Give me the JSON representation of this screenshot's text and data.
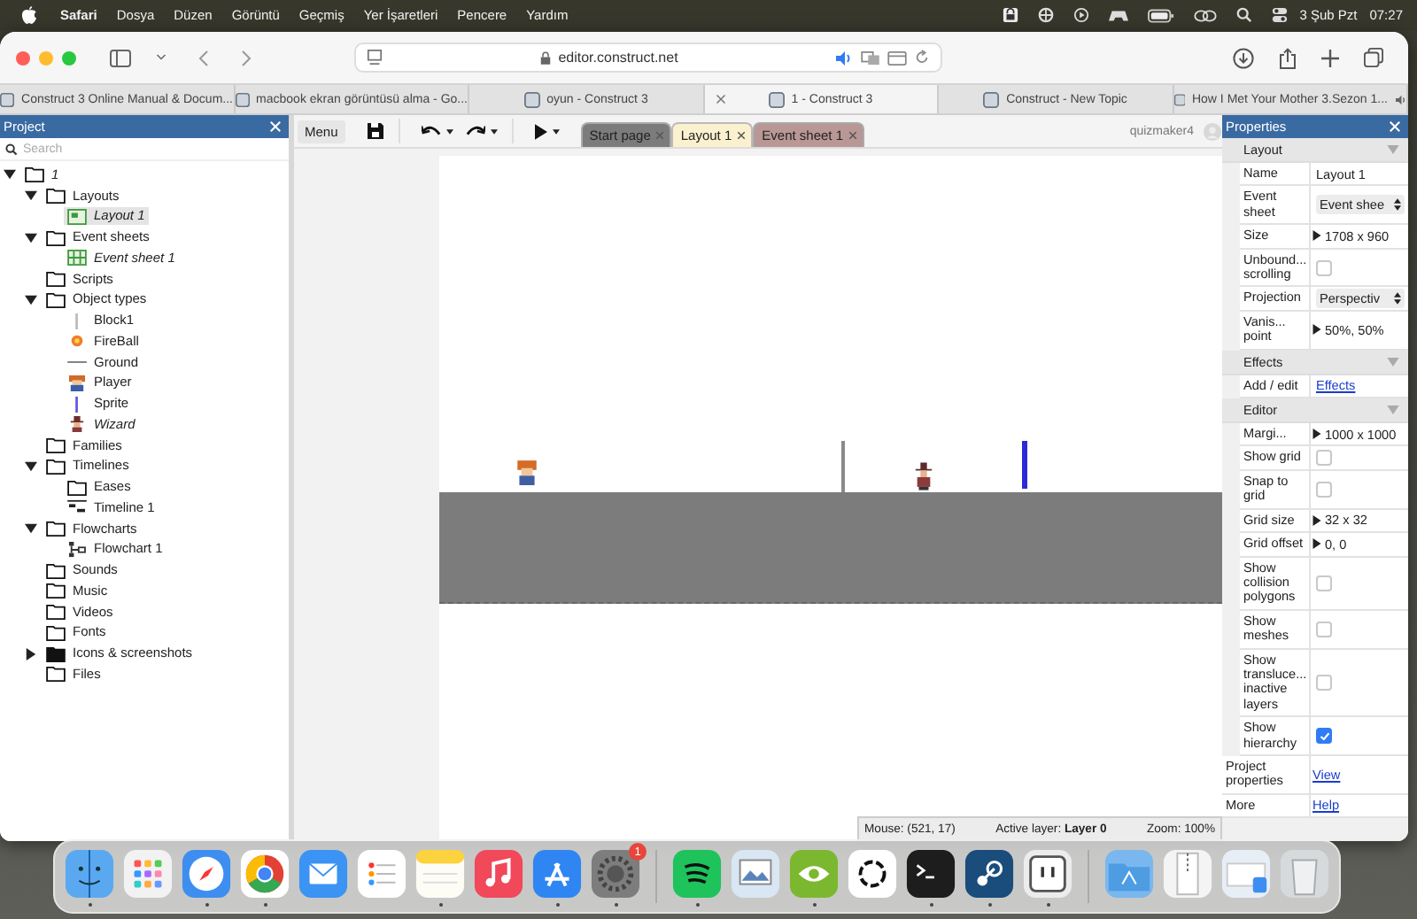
{
  "menu_bar": {
    "app": "Safari",
    "menus": [
      "Dosya",
      "Düzen",
      "Görüntü",
      "Geçmiş",
      "Yer İşaretleri",
      "Pencere",
      "Yardım"
    ],
    "date": "3 Şub Pzt",
    "time": "07:27"
  },
  "browser": {
    "address": "editor.construct.net",
    "tabs": [
      {
        "title": "Construct 3 Online Manual & Docum...",
        "selected": false,
        "audio": false
      },
      {
        "title": "macbook ekran görüntüsü alma - Go...",
        "selected": false,
        "audio": false
      },
      {
        "title": "oyun - Construct 3",
        "selected": false,
        "audio": false
      },
      {
        "title": "1 - Construct 3",
        "selected": true,
        "audio": false
      },
      {
        "title": "Construct - New Topic",
        "selected": false,
        "audio": false
      },
      {
        "title": "How I Met Your Mother 3.Sezon 1...",
        "selected": false,
        "audio": true
      }
    ]
  },
  "toolbar": {
    "menu": "Menu",
    "user": "quizmaker4",
    "tabs": [
      {
        "label": "Start page",
        "color": "#7c7c7c",
        "selected": false
      },
      {
        "label": "Layout 1",
        "color": "#fbf1cf",
        "selected": true
      },
      {
        "label": "Event sheet 1",
        "color": "#b89795",
        "selected": false
      }
    ]
  },
  "project": {
    "title": "Project",
    "search_placeholder": "Search",
    "tree": [
      {
        "label": "1",
        "kind": "folder",
        "italic": true,
        "selected": false,
        "expanded": true,
        "children": [
          {
            "label": "Layouts",
            "kind": "folder",
            "italic": false,
            "selected": false,
            "expanded": true,
            "children": [
              {
                "label": "Layout 1",
                "kind": "layout",
                "italic": true,
                "selected": true
              }
            ]
          },
          {
            "label": "Event sheets",
            "kind": "folder",
            "italic": false,
            "selected": false,
            "expanded": true,
            "children": [
              {
                "label": "Event sheet 1",
                "kind": "eventsheet",
                "italic": true,
                "selected": false
              }
            ]
          },
          {
            "label": "Scripts",
            "kind": "folder",
            "italic": false,
            "selected": false
          },
          {
            "label": "Object types",
            "kind": "folder",
            "italic": false,
            "selected": false,
            "expanded": true,
            "children": [
              {
                "label": "Block1",
                "kind": "block",
                "italic": false,
                "selected": false
              },
              {
                "label": "FireBall",
                "kind": "fireball",
                "italic": false,
                "selected": false
              },
              {
                "label": "Ground",
                "kind": "ground",
                "italic": false,
                "selected": false
              },
              {
                "label": "Player",
                "kind": "player",
                "italic": false,
                "selected": false
              },
              {
                "label": "Sprite",
                "kind": "sprite",
                "italic": false,
                "selected": false
              },
              {
                "label": "Wizard",
                "kind": "wizard",
                "italic": true,
                "selected": false
              }
            ]
          },
          {
            "label": "Families",
            "kind": "folder",
            "italic": false,
            "selected": false
          },
          {
            "label": "Timelines",
            "kind": "folder",
            "italic": false,
            "selected": false,
            "expanded": true,
            "children": [
              {
                "label": "Eases",
                "kind": "folder",
                "italic": false,
                "selected": false
              },
              {
                "label": "Timeline 1",
                "kind": "timeline",
                "italic": false,
                "selected": false
              }
            ]
          },
          {
            "label": "Flowcharts",
            "kind": "folder",
            "italic": false,
            "selected": false,
            "expanded": true,
            "children": [
              {
                "label": "Flowchart 1",
                "kind": "flowchart",
                "italic": false,
                "selected": false
              }
            ]
          },
          {
            "label": "Sounds",
            "kind": "folder",
            "italic": false,
            "selected": false
          },
          {
            "label": "Music",
            "kind": "folder",
            "italic": false,
            "selected": false
          },
          {
            "label": "Videos",
            "kind": "folder",
            "italic": false,
            "selected": false
          },
          {
            "label": "Fonts",
            "kind": "folder",
            "italic": false,
            "selected": false
          },
          {
            "label": "Icons & screenshots",
            "kind": "folder",
            "italic": false,
            "selected": false,
            "expanded": false
          },
          {
            "label": "Files",
            "kind": "folder",
            "italic": false,
            "selected": false
          }
        ]
      }
    ]
  },
  "status_bar": {
    "mouse": "Mouse: (521, 17)",
    "layer": "Active layer: **Layer 0**",
    "zoom": "Zoom: 100%"
  },
  "properties": {
    "title": "Properties",
    "sections": [
      {
        "title": "Layout",
        "expanded": true,
        "rows": [
          {
            "label": "Name",
            "kind": "text",
            "value": "Layout 1",
            "expandable": false
          },
          {
            "label": "Event sheet",
            "kind": "dropdown",
            "value": "Event shee",
            "expandable": false
          },
          {
            "label": "Size",
            "kind": "text",
            "value": "1708 x 960",
            "expandable": true
          },
          {
            "label": "Unbound... scrolling",
            "kind": "checkbox",
            "checked": false,
            "expandable": false
          },
          {
            "label": "Projection",
            "kind": "dropdown",
            "value": "Perspectiv",
            "expandable": false
          },
          {
            "label": "Vanis... point",
            "kind": "text",
            "value": "50%, 50%",
            "expandable": true
          }
        ]
      },
      {
        "title": "Effects",
        "expanded": true,
        "rows": [
          {
            "label": "Add / edit",
            "kind": "link",
            "value": "Effects",
            "expandable": false
          }
        ]
      },
      {
        "title": "Editor",
        "expanded": true,
        "rows": [
          {
            "label": "Margi...",
            "kind": "text",
            "value": "1000 x 1000",
            "expandable": true
          },
          {
            "label": "Show grid",
            "kind": "checkbox",
            "checked": false,
            "expandable": false
          },
          {
            "label": "Snap to grid",
            "kind": "checkbox",
            "checked": false,
            "expandable": false
          },
          {
            "label": "Grid size",
            "kind": "text",
            "value": "32 x 32",
            "expandable": true
          },
          {
            "label": "Grid offset",
            "kind": "text",
            "value": "0, 0",
            "expandable": true
          },
          {
            "label": "Show collision polygons",
            "kind": "checkbox",
            "checked": false,
            "expandable": false
          },
          {
            "label": "Show meshes",
            "kind": "checkbox",
            "checked": false,
            "expandable": false
          },
          {
            "label": "Show transluce... inactive layers",
            "kind": "checkbox",
            "checked": false,
            "expandable": false
          },
          {
            "label": "Show hierarchy",
            "kind": "checkbox",
            "checked": true,
            "expandable": false
          }
        ]
      }
    ],
    "footer": [
      {
        "label": "Project properties",
        "link": "View"
      },
      {
        "label": "More",
        "link": "Help"
      }
    ]
  },
  "dock": {
    "groups": [
      [
        {
          "kind": "finder",
          "running": true
        },
        {
          "kind": "launchpad",
          "running": false
        },
        {
          "kind": "safari",
          "running": true
        },
        {
          "kind": "chrome",
          "running": true
        },
        {
          "kind": "mail",
          "running": false
        },
        {
          "kind": "reminders",
          "running": false
        },
        {
          "kind": "notes",
          "running": true
        },
        {
          "kind": "music",
          "running": false
        },
        {
          "kind": "appstore",
          "running": true
        },
        {
          "kind": "settings",
          "running": true,
          "badge": "1"
        }
      ],
      [
        {
          "kind": "spotify",
          "running": true
        },
        {
          "kind": "preview",
          "running": false
        },
        {
          "kind": "nvidia",
          "running": true
        },
        {
          "kind": "chatgpt",
          "running": false
        },
        {
          "kind": "terminal",
          "running": true
        },
        {
          "kind": "steam",
          "running": true
        },
        {
          "kind": "box",
          "running": true
        }
      ],
      [
        {
          "kind": "folder",
          "running": false
        },
        {
          "kind": "zip",
          "running": false
        },
        {
          "kind": "screenshot",
          "running": false
        },
        {
          "kind": "trash",
          "running": false
        }
      ]
    ]
  }
}
